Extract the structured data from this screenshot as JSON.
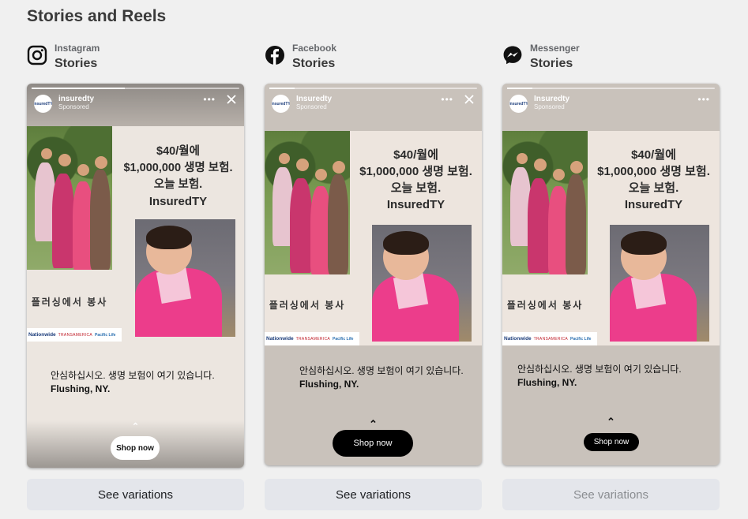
{
  "section_title": "Stories and Reels",
  "columns": [
    {
      "platform": "Instagram",
      "placement": "Stories",
      "icon": "instagram-icon",
      "account": "insuredty",
      "sponsored": "Sponsored",
      "headline_line1": "$40/월에",
      "headline_line2": "$1,000,000 생명 보험.",
      "headline_line3": "오늘 보험.",
      "headline_brand": "InsuredTY",
      "korean_sub": "플러싱에서 봉사",
      "logo_nationwide": "Nationwide",
      "logo_transamerica": "TRANSAMERICA",
      "logo_pacific": "Pacific Life",
      "caption_line1": "안심하십시오. 생명 보험이 여기 있습니다.",
      "caption_line2": "Flushing, NY.",
      "cta": "Shop now",
      "see_variations": "See variations",
      "see_variations_enabled": true
    },
    {
      "platform": "Facebook",
      "placement": "Stories",
      "icon": "facebook-icon",
      "account": "Insuredty",
      "sponsored": "Sponsored",
      "headline_line1": "$40/월에",
      "headline_line2": "$1,000,000 생명 보험.",
      "headline_line3": "오늘 보험.",
      "headline_brand": "InsuredTY",
      "korean_sub": "플러싱에서 봉사",
      "logo_nationwide": "Nationwide",
      "logo_transamerica": "TRANSAMERICA",
      "logo_pacific": "Pacific Life",
      "caption_line1": "안심하십시오. 생명 보험이 여기 있습니다.",
      "caption_line2": "Flushing, NY.",
      "cta": "Shop now",
      "see_variations": "See variations",
      "see_variations_enabled": true
    },
    {
      "platform": "Messenger",
      "placement": "Stories",
      "icon": "messenger-icon",
      "account": "Insuredty",
      "sponsored": "Sponsored",
      "headline_line1": "$40/월에",
      "headline_line2": "$1,000,000 생명 보험.",
      "headline_line3": "오늘 보험.",
      "headline_brand": "InsuredTY",
      "korean_sub": "플러싱에서 봉사",
      "logo_nationwide": "Nationwide",
      "logo_transamerica": "TRANSAMERICA",
      "logo_pacific": "Pacific Life",
      "caption_line1": "안심하십시오. 생명 보험이 여기 있습니다.",
      "caption_line2": "Flushing, NY.",
      "cta": "Shop now",
      "see_variations": "See variations",
      "see_variations_enabled": false
    }
  ],
  "colors": {
    "page_bg": "#f0f0f0",
    "button_bg": "#e4e6eb",
    "disabled_text": "#8a8d91"
  }
}
